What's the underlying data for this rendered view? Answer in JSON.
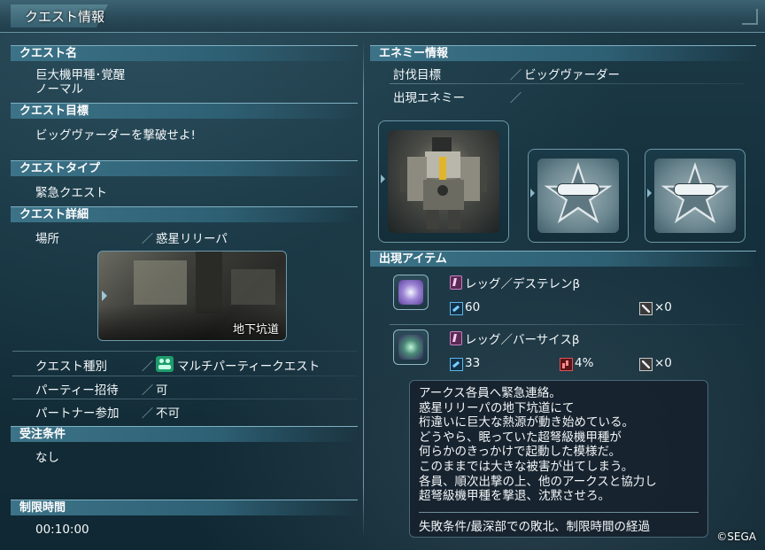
{
  "window": {
    "title": "クエスト情報"
  },
  "left": {
    "quest_name_header": "クエスト名",
    "quest_name_line1": "巨大機甲種･覚醒",
    "quest_name_line2": "ノーマル",
    "objective_header": "クエスト目標",
    "objective_text": "ビッグヴァーダーを撃破せよ!",
    "type_header": "クエストタイプ",
    "type_text": "緊急クエスト",
    "detail_header": "クエスト詳細",
    "location_label": "場所",
    "location_value": "惑星リリーパ",
    "location_area": "地下坑道",
    "category_label": "クエスト種別",
    "category_value": "マルチパーティークエスト",
    "party_invite_label": "パーティー招待",
    "party_invite_value": "可",
    "partner_label": "パートナー参加",
    "partner_value": "不可",
    "conditions_header": "受注条件",
    "conditions_text": "なし",
    "time_limit_header": "制限時間",
    "time_limit_value": "00:10:00",
    "separator": "／"
  },
  "right": {
    "enemy_header": "エネミー情報",
    "target_label": "討伐目標",
    "target_value": "ビッグヴァーダー",
    "appear_enemy_label": "出現エネミー",
    "items_header": "出現アイテム",
    "items": [
      {
        "name": "レッグ／デステレンβ",
        "stat": "60",
        "drop_rate": "",
        "count": "×0"
      },
      {
        "name": "レッグ／バーサイスβ",
        "stat": "33",
        "drop_rate": "4%",
        "count": "×0"
      }
    ]
  },
  "tooltip": {
    "lines": [
      "アークス各員へ緊急連絡。",
      "惑星リリーパの地下坑道にて",
      "桁違いに巨大な熱源が動き始めている。",
      "どうやら、眠っていた超弩級機甲種が",
      "何らかのきっかけで起動した模様だ。",
      "このままでは大きな被害が出てしまう。",
      "各員、順次出撃の上、他のアークスと協力し",
      "超弩級機甲種を撃退、沈黙させろ。"
    ],
    "failure": "失敗条件/最深部での敗北、制限時間の経過"
  },
  "footer": {
    "copyright": "©SEGA"
  }
}
